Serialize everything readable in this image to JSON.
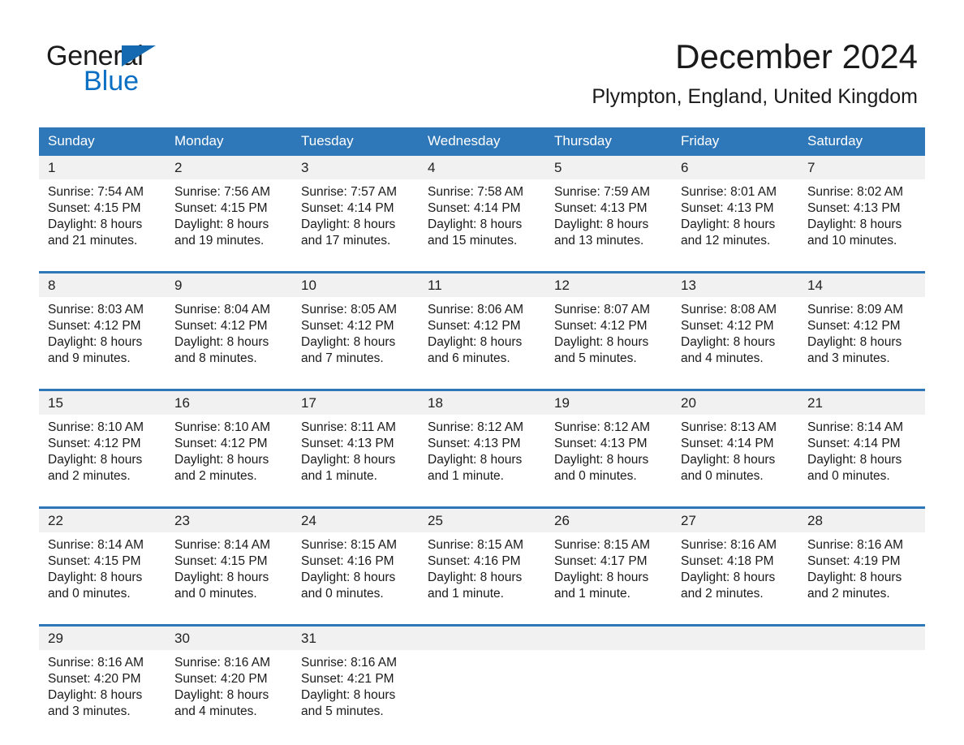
{
  "brand": {
    "name_part1": "General",
    "name_part2": "Blue",
    "flag_icon": "triangle-flag-icon",
    "accent_color": "#1569b0",
    "text_color": "#0b6fc4"
  },
  "header": {
    "title": "December 2024",
    "subtitle": "Plympton, England, United Kingdom"
  },
  "calendar": {
    "header_bg": "#2e77b8",
    "daynum_bg": "#f1f1f1",
    "columns": [
      "Sunday",
      "Monday",
      "Tuesday",
      "Wednesday",
      "Thursday",
      "Friday",
      "Saturday"
    ],
    "weeks": [
      {
        "days": [
          {
            "num": "1",
            "sunrise": "Sunrise: 7:54 AM",
            "sunset": "Sunset: 4:15 PM",
            "daylight1": "Daylight: 8 hours",
            "daylight2": "and 21 minutes."
          },
          {
            "num": "2",
            "sunrise": "Sunrise: 7:56 AM",
            "sunset": "Sunset: 4:15 PM",
            "daylight1": "Daylight: 8 hours",
            "daylight2": "and 19 minutes."
          },
          {
            "num": "3",
            "sunrise": "Sunrise: 7:57 AM",
            "sunset": "Sunset: 4:14 PM",
            "daylight1": "Daylight: 8 hours",
            "daylight2": "and 17 minutes."
          },
          {
            "num": "4",
            "sunrise": "Sunrise: 7:58 AM",
            "sunset": "Sunset: 4:14 PM",
            "daylight1": "Daylight: 8 hours",
            "daylight2": "and 15 minutes."
          },
          {
            "num": "5",
            "sunrise": "Sunrise: 7:59 AM",
            "sunset": "Sunset: 4:13 PM",
            "daylight1": "Daylight: 8 hours",
            "daylight2": "and 13 minutes."
          },
          {
            "num": "6",
            "sunrise": "Sunrise: 8:01 AM",
            "sunset": "Sunset: 4:13 PM",
            "daylight1": "Daylight: 8 hours",
            "daylight2": "and 12 minutes."
          },
          {
            "num": "7",
            "sunrise": "Sunrise: 8:02 AM",
            "sunset": "Sunset: 4:13 PM",
            "daylight1": "Daylight: 8 hours",
            "daylight2": "and 10 minutes."
          }
        ]
      },
      {
        "days": [
          {
            "num": "8",
            "sunrise": "Sunrise: 8:03 AM",
            "sunset": "Sunset: 4:12 PM",
            "daylight1": "Daylight: 8 hours",
            "daylight2": "and 9 minutes."
          },
          {
            "num": "9",
            "sunrise": "Sunrise: 8:04 AM",
            "sunset": "Sunset: 4:12 PM",
            "daylight1": "Daylight: 8 hours",
            "daylight2": "and 8 minutes."
          },
          {
            "num": "10",
            "sunrise": "Sunrise: 8:05 AM",
            "sunset": "Sunset: 4:12 PM",
            "daylight1": "Daylight: 8 hours",
            "daylight2": "and 7 minutes."
          },
          {
            "num": "11",
            "sunrise": "Sunrise: 8:06 AM",
            "sunset": "Sunset: 4:12 PM",
            "daylight1": "Daylight: 8 hours",
            "daylight2": "and 6 minutes."
          },
          {
            "num": "12",
            "sunrise": "Sunrise: 8:07 AM",
            "sunset": "Sunset: 4:12 PM",
            "daylight1": "Daylight: 8 hours",
            "daylight2": "and 5 minutes."
          },
          {
            "num": "13",
            "sunrise": "Sunrise: 8:08 AM",
            "sunset": "Sunset: 4:12 PM",
            "daylight1": "Daylight: 8 hours",
            "daylight2": "and 4 minutes."
          },
          {
            "num": "14",
            "sunrise": "Sunrise: 8:09 AM",
            "sunset": "Sunset: 4:12 PM",
            "daylight1": "Daylight: 8 hours",
            "daylight2": "and 3 minutes."
          }
        ]
      },
      {
        "days": [
          {
            "num": "15",
            "sunrise": "Sunrise: 8:10 AM",
            "sunset": "Sunset: 4:12 PM",
            "daylight1": "Daylight: 8 hours",
            "daylight2": "and 2 minutes."
          },
          {
            "num": "16",
            "sunrise": "Sunrise: 8:10 AM",
            "sunset": "Sunset: 4:12 PM",
            "daylight1": "Daylight: 8 hours",
            "daylight2": "and 2 minutes."
          },
          {
            "num": "17",
            "sunrise": "Sunrise: 8:11 AM",
            "sunset": "Sunset: 4:13 PM",
            "daylight1": "Daylight: 8 hours",
            "daylight2": "and 1 minute."
          },
          {
            "num": "18",
            "sunrise": "Sunrise: 8:12 AM",
            "sunset": "Sunset: 4:13 PM",
            "daylight1": "Daylight: 8 hours",
            "daylight2": "and 1 minute."
          },
          {
            "num": "19",
            "sunrise": "Sunrise: 8:12 AM",
            "sunset": "Sunset: 4:13 PM",
            "daylight1": "Daylight: 8 hours",
            "daylight2": "and 0 minutes."
          },
          {
            "num": "20",
            "sunrise": "Sunrise: 8:13 AM",
            "sunset": "Sunset: 4:14 PM",
            "daylight1": "Daylight: 8 hours",
            "daylight2": "and 0 minutes."
          },
          {
            "num": "21",
            "sunrise": "Sunrise: 8:14 AM",
            "sunset": "Sunset: 4:14 PM",
            "daylight1": "Daylight: 8 hours",
            "daylight2": "and 0 minutes."
          }
        ]
      },
      {
        "days": [
          {
            "num": "22",
            "sunrise": "Sunrise: 8:14 AM",
            "sunset": "Sunset: 4:15 PM",
            "daylight1": "Daylight: 8 hours",
            "daylight2": "and 0 minutes."
          },
          {
            "num": "23",
            "sunrise": "Sunrise: 8:14 AM",
            "sunset": "Sunset: 4:15 PM",
            "daylight1": "Daylight: 8 hours",
            "daylight2": "and 0 minutes."
          },
          {
            "num": "24",
            "sunrise": "Sunrise: 8:15 AM",
            "sunset": "Sunset: 4:16 PM",
            "daylight1": "Daylight: 8 hours",
            "daylight2": "and 0 minutes."
          },
          {
            "num": "25",
            "sunrise": "Sunrise: 8:15 AM",
            "sunset": "Sunset: 4:16 PM",
            "daylight1": "Daylight: 8 hours",
            "daylight2": "and 1 minute."
          },
          {
            "num": "26",
            "sunrise": "Sunrise: 8:15 AM",
            "sunset": "Sunset: 4:17 PM",
            "daylight1": "Daylight: 8 hours",
            "daylight2": "and 1 minute."
          },
          {
            "num": "27",
            "sunrise": "Sunrise: 8:16 AM",
            "sunset": "Sunset: 4:18 PM",
            "daylight1": "Daylight: 8 hours",
            "daylight2": "and 2 minutes."
          },
          {
            "num": "28",
            "sunrise": "Sunrise: 8:16 AM",
            "sunset": "Sunset: 4:19 PM",
            "daylight1": "Daylight: 8 hours",
            "daylight2": "and 2 minutes."
          }
        ]
      },
      {
        "days": [
          {
            "num": "29",
            "sunrise": "Sunrise: 8:16 AM",
            "sunset": "Sunset: 4:20 PM",
            "daylight1": "Daylight: 8 hours",
            "daylight2": "and 3 minutes."
          },
          {
            "num": "30",
            "sunrise": "Sunrise: 8:16 AM",
            "sunset": "Sunset: 4:20 PM",
            "daylight1": "Daylight: 8 hours",
            "daylight2": "and 4 minutes."
          },
          {
            "num": "31",
            "sunrise": "Sunrise: 8:16 AM",
            "sunset": "Sunset: 4:21 PM",
            "daylight1": "Daylight: 8 hours",
            "daylight2": "and 5 minutes."
          },
          {
            "num": "",
            "sunrise": "",
            "sunset": "",
            "daylight1": "",
            "daylight2": ""
          },
          {
            "num": "",
            "sunrise": "",
            "sunset": "",
            "daylight1": "",
            "daylight2": ""
          },
          {
            "num": "",
            "sunrise": "",
            "sunset": "",
            "daylight1": "",
            "daylight2": ""
          },
          {
            "num": "",
            "sunrise": "",
            "sunset": "",
            "daylight1": "",
            "daylight2": ""
          }
        ]
      }
    ]
  }
}
